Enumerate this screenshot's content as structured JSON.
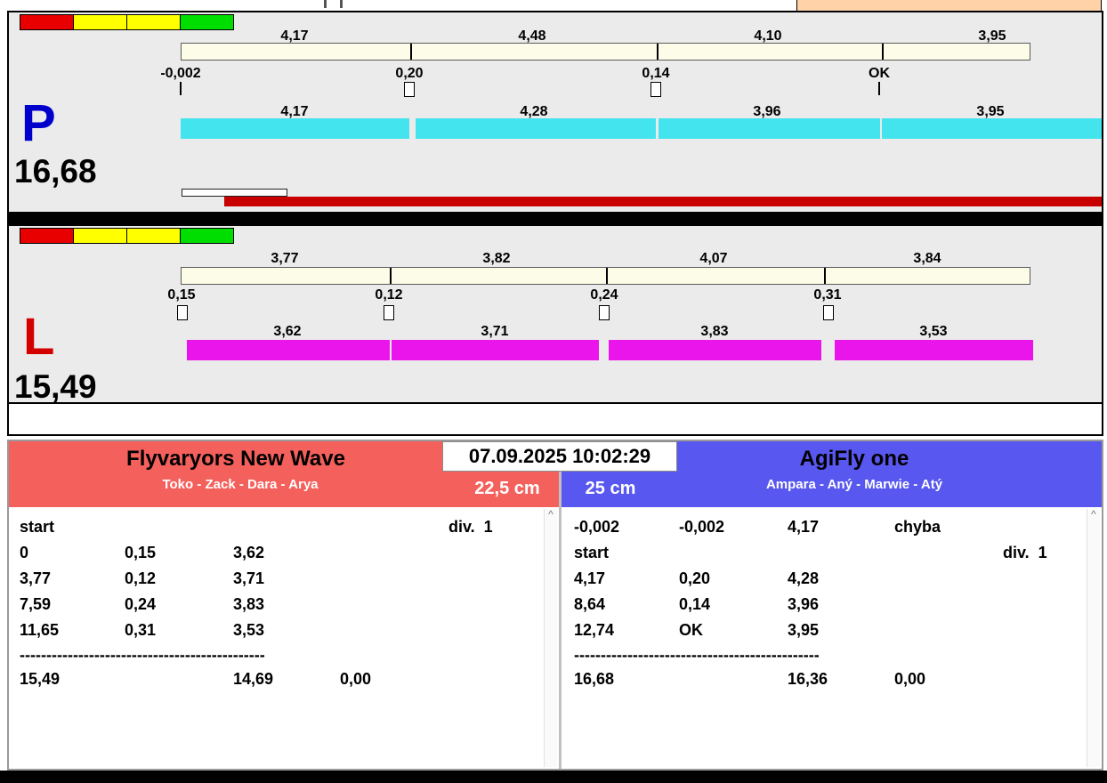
{
  "panel_p": {
    "lane_label": "P",
    "total": "16,68",
    "top_values": [
      "4,17",
      "4,48",
      "4,10",
      "3,95"
    ],
    "split_values": [
      "-0,002",
      "0,20",
      "0,14",
      "OK"
    ],
    "run_values": [
      "4,17",
      "4,28",
      "3,96",
      "3,95"
    ]
  },
  "panel_l": {
    "lane_label": "L",
    "total": "15,49",
    "top_values": [
      "3,77",
      "3,82",
      "4,07",
      "3,84"
    ],
    "split_values": [
      "0,15",
      "0,12",
      "0,24",
      "0,31"
    ],
    "run_values": [
      "3,62",
      "3,71",
      "3,83",
      "3,53"
    ]
  },
  "scoreboard": {
    "timestamp": "07.09.2025 10:02:29",
    "left": {
      "team": "Flyvaryors New Wave",
      "dogs": "Toko - Zack - Dara - Arya",
      "height": "22,5 cm",
      "log": [
        {
          "c1": "start",
          "c2": "",
          "c3": "",
          "c4": "",
          "c5": "div.  1"
        },
        {
          "c1": "0",
          "c2": "0,15",
          "c3": "3,62",
          "c4": "",
          "c5": ""
        },
        {
          "c1": "3,77",
          "c2": "0,12",
          "c3": "3,71",
          "c4": "",
          "c5": ""
        },
        {
          "c1": "7,59",
          "c2": "0,24",
          "c3": "3,83",
          "c4": "",
          "c5": ""
        },
        {
          "c1": "11,65",
          "c2": "0,31",
          "c3": "3,53",
          "c4": "",
          "c5": ""
        }
      ],
      "separator": "----------------------------------------------",
      "totals": {
        "c1": "15,49",
        "c2": "",
        "c3": "14,69",
        "c4": "0,00",
        "c5": ""
      }
    },
    "right": {
      "team": "AgiFly one",
      "dogs": "Ampara - Aný - Marwie - Atý",
      "height": "25 cm",
      "log": [
        {
          "c1": "-0,002",
          "c2": "-0,002",
          "c3": "4,17",
          "c4": "chyba",
          "c5": ""
        },
        {
          "c1": "start",
          "c2": "",
          "c3": "",
          "c4": "",
          "c5": "div.  1"
        },
        {
          "c1": "4,17",
          "c2": "0,20",
          "c3": "4,28",
          "c4": "",
          "c5": ""
        },
        {
          "c1": "8,64",
          "c2": "0,14",
          "c3": "3,96",
          "c4": "",
          "c5": ""
        },
        {
          "c1": "12,74",
          "c2": "OK",
          "c3": "3,95",
          "c4": "",
          "c5": ""
        }
      ],
      "separator": "----------------------------------------------",
      "totals": {
        "c1": "16,68",
        "c2": "",
        "c3": "16,36",
        "c4": "0,00",
        "c5": ""
      }
    }
  },
  "icons": {
    "scroll_up": "^"
  },
  "colors": {
    "run_bar_p": "#44e4ee",
    "run_bar_l": "#ea15ea",
    "progress_bar": "#c80000",
    "team_left_bg": "#f4605c",
    "team_right_bg": "#5857f0",
    "lane_p_text": "#0000cd",
    "lane_l_text": "#d40000",
    "light_colors": [
      "#e80000",
      "#ffff00",
      "#ffff00",
      "#00dd00"
    ],
    "corner_box": "#ffd2a8"
  }
}
